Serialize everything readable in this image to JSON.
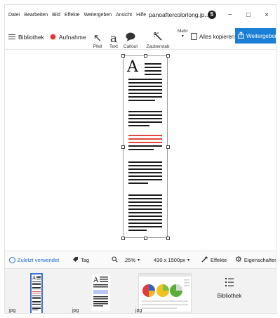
{
  "menu": [
    "Datei",
    "Bearbeiten",
    "Bild",
    "Effekte",
    "Weitergeben",
    "Ansicht",
    "Hilfe"
  ],
  "filename": "panoaftercolorlong.jp...",
  "badge": "5",
  "window_controls": [
    "−",
    "□",
    "×"
  ],
  "toolbar": {
    "library_label": "Bibliothek",
    "record_label": "Aufnahme",
    "tools": [
      {
        "label": "Pfeil",
        "icon": "arrow-icon",
        "glyph": "↖"
      },
      {
        "label": "Text",
        "icon": "text-icon",
        "glyph": "a"
      },
      {
        "label": "Callout",
        "icon": "callout-icon",
        "glyph": "💬"
      },
      {
        "label": "Zauberstab",
        "icon": "magic-wand-icon",
        "glyph": "⁂"
      }
    ],
    "more_label": "Mehr",
    "copy_all_label": "Alles kopieren",
    "share_label": "Weitergeben"
  },
  "status": {
    "recent_label": "Zuletzt verwendet",
    "tag_label": "Tag",
    "zoom": "25%",
    "size": "430 x 1500px",
    "effects_label": "Effekte",
    "properties_label": "Eigenschaften"
  },
  "tray": {
    "items": [
      {
        "label": "jpg"
      },
      {
        "label": "jpg"
      },
      {
        "label": "jpg"
      }
    ],
    "library_label": "Bibliothek"
  },
  "colors": {
    "accent": "#1a7fd6",
    "record": "#e0332f",
    "highlight": "#e0463f",
    "recent": "#1a6fc4"
  }
}
